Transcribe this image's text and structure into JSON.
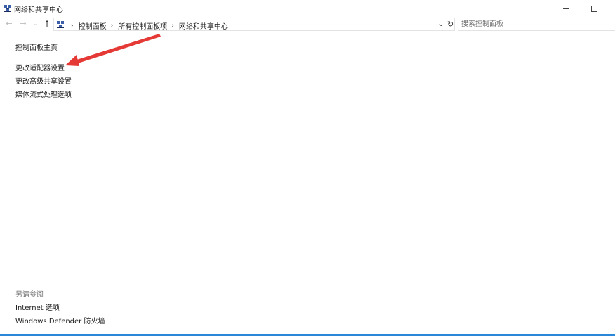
{
  "window": {
    "title": "网络和共享中心",
    "accent_color": "#2b88d8",
    "annotation_color": "#e53935"
  },
  "nav": {
    "back_icon": "arrow-left-icon",
    "forward_icon": "arrow-right-icon",
    "recent_icon": "chevron-down-icon",
    "up_icon": "arrow-up-icon"
  },
  "address": {
    "crumbs": [
      "控制面板",
      "所有控制面板项",
      "网络和共享中心"
    ]
  },
  "search": {
    "placeholder": "搜索控制面板"
  },
  "sidebar": {
    "home": "控制面板主页",
    "links": [
      "更改适配器设置",
      "更改高级共享设置",
      "媒体流式处理选项"
    ]
  },
  "see_also": {
    "label": "另请参阅",
    "links": [
      "Internet 选项",
      "Windows Defender 防火墙"
    ]
  }
}
